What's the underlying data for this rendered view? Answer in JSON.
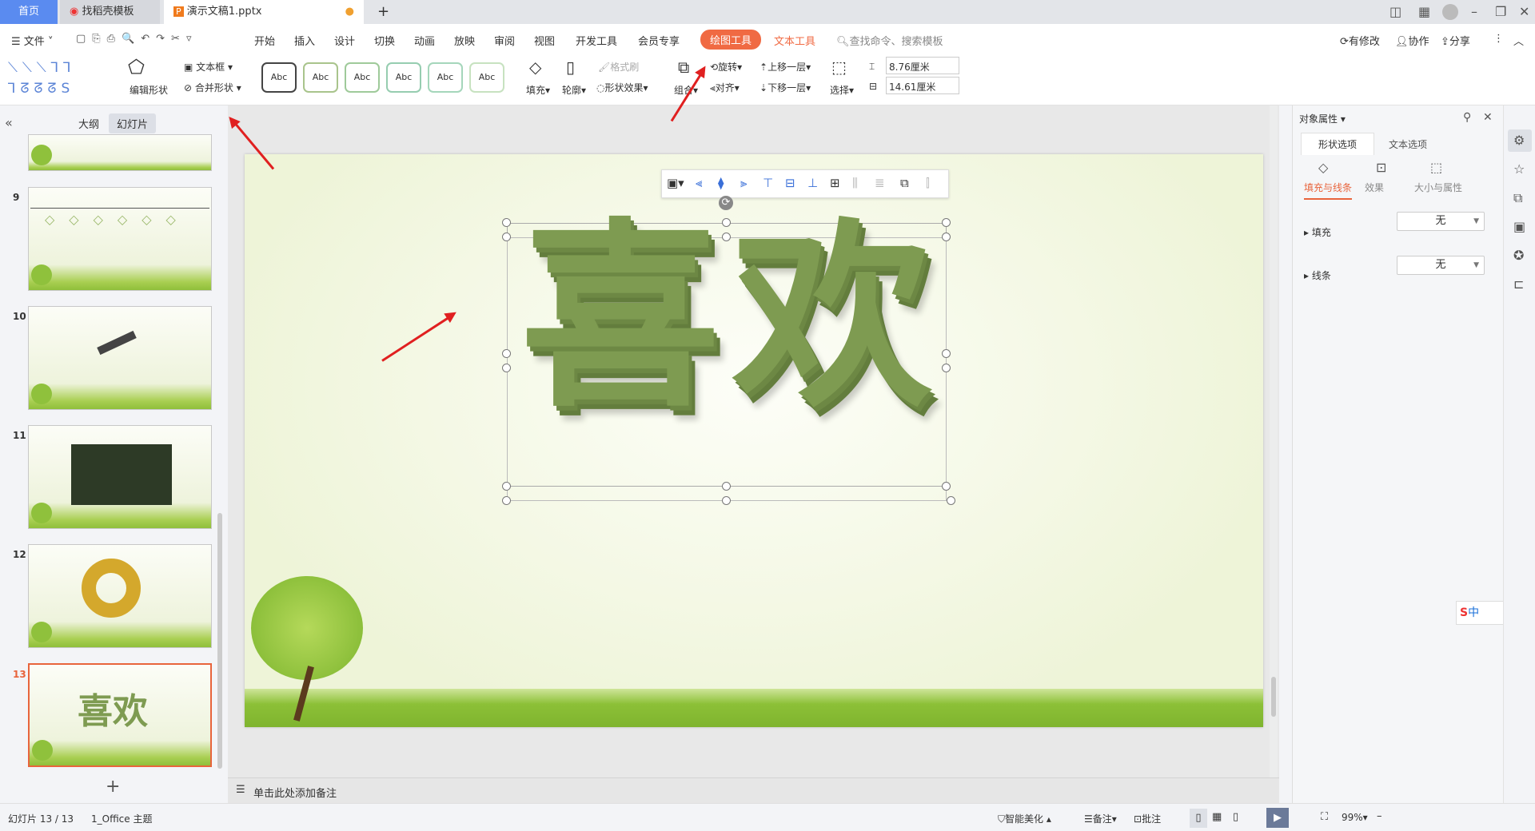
{
  "tabs": [
    {
      "label": "首页"
    },
    {
      "label": "找稻壳模板"
    },
    {
      "label": "演示文稿1.pptx"
    }
  ],
  "menu": {
    "file": "文件",
    "items": [
      "开始",
      "插入",
      "设计",
      "切换",
      "动画",
      "放映",
      "审阅",
      "视图",
      "开发工具",
      "会员专享"
    ],
    "drawing_tools": "绘图工具",
    "text_tools": "文本工具",
    "search": "查找命令、搜索模板",
    "modified": "有修改",
    "collab": "协作",
    "share": "分享"
  },
  "ribbon": {
    "edit_shape": "编辑形状",
    "textbox": "文本框",
    "merge_shape": "合并形状",
    "style_label": "Abc",
    "fill": "填充",
    "outline": "轮廓",
    "format_painter": "格式刷",
    "shape_effect": "形状效果",
    "group": "组合",
    "rotate": "旋转",
    "align": "对齐",
    "bring_forward": "上移一层",
    "send_backward": "下移一层",
    "select": "选择",
    "height": "8.76厘米",
    "width": "14.61厘米"
  },
  "left": {
    "outline_tab": "大纲",
    "slides_tab": "幻灯片",
    "slides": [
      {
        "num": "9"
      },
      {
        "num": "10"
      },
      {
        "num": "11"
      },
      {
        "num": "12"
      },
      {
        "num": "13",
        "title": "喜欢"
      }
    ]
  },
  "slide": {
    "text1": "喜",
    "text2": "欢"
  },
  "notes": "单击此处添加备注",
  "status": {
    "slide": "幻灯片 13 / 13",
    "theme": "1_Office 主题",
    "beautify": "智能美化",
    "notes": "备注",
    "comment": "批注",
    "zoom": "99%"
  },
  "rpanel": {
    "title": "对象属性",
    "tab_shape": "形状选项",
    "tab_text": "文本选项",
    "sub_fill": "填充与线条",
    "sub_effect": "效果",
    "sub_size": "大小与属性",
    "fill_label": "填充",
    "fill_value": "无",
    "line_label": "线条",
    "line_value": "无"
  },
  "colors": {
    "accent": "#e8643c",
    "drawing_tab": "#f06a43",
    "text_green": "#7e9b51"
  }
}
